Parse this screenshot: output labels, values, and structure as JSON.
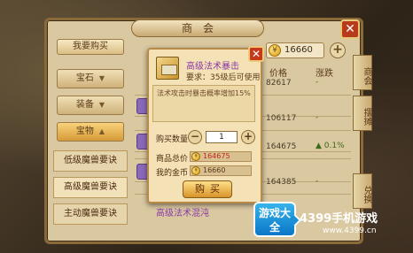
{
  "shop": {
    "title": "商会",
    "coins": "16660",
    "buy_tab": "我要购买"
  },
  "categories": [
    {
      "label": "宝石"
    },
    {
      "label": "装备"
    },
    {
      "label": "宝物"
    }
  ],
  "subitems": [
    {
      "label": "低级魔兽要诀"
    },
    {
      "label": "高级魔兽要诀"
    },
    {
      "label": "主动魔兽要诀"
    }
  ],
  "list": {
    "col_price": "价格",
    "col_change": "涨跌",
    "rows": [
      {
        "price": "82617",
        "change": "-"
      },
      {
        "price": "",
        "change": ""
      },
      {
        "price": "106117",
        "change": "-"
      },
      {
        "price": "",
        "change": ""
      },
      {
        "price": "164675",
        "change": "0.1%"
      },
      {
        "price": "",
        "change": ""
      },
      {
        "price": "164385",
        "change": "-"
      }
    ]
  },
  "side_tabs": [
    {
      "label": "商会"
    },
    {
      "label": "摆摊"
    },
    {
      "label": "兑换"
    }
  ],
  "popup": {
    "item_name": "高级法术暴击",
    "requirement": "要求：35级后可使用",
    "description": "法术攻击时暴击概率增加15%",
    "qty_label": "购买数量",
    "qty_value": "1",
    "total_label": "商品总价",
    "total_value": "164675",
    "mine_label": "我的金币",
    "mine_value": "16660",
    "buy_label": "购买",
    "bottom_item": "高级法术混沌"
  },
  "logo": {
    "badge": "游戏大全",
    "name": "4399手机游戏",
    "url": "www.4399.cn"
  }
}
